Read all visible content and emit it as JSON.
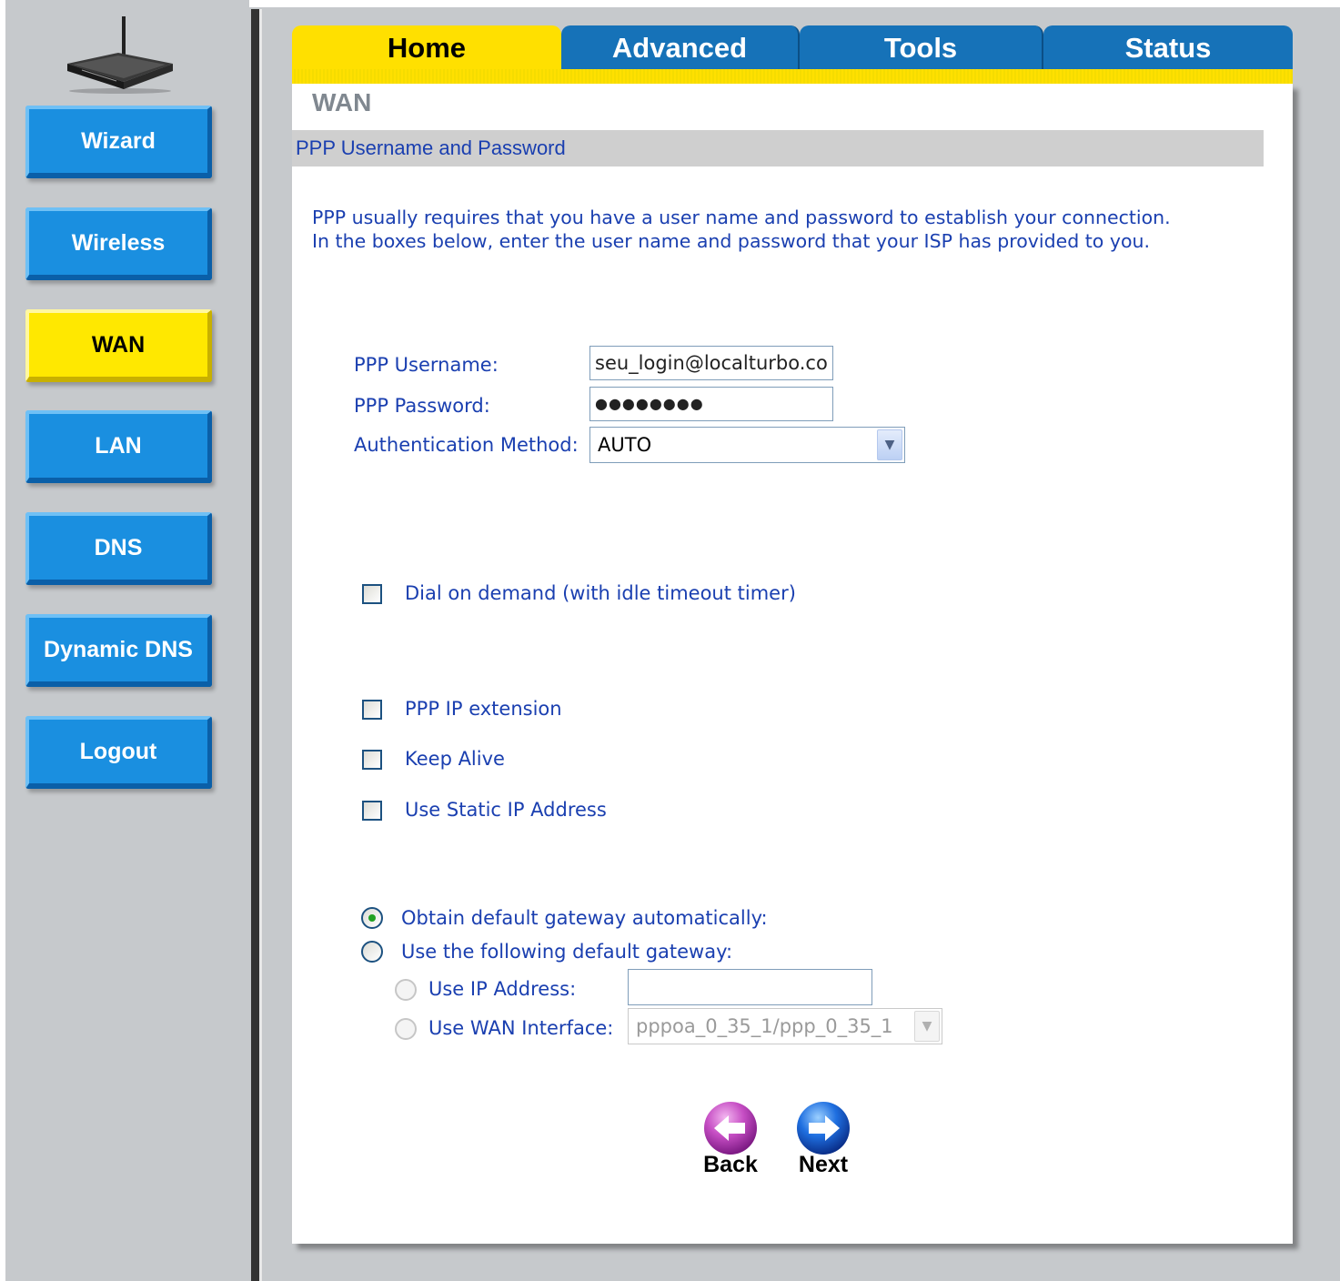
{
  "sidebar": {
    "items": [
      {
        "label": "Wizard",
        "active": false
      },
      {
        "label": "Wireless",
        "active": false
      },
      {
        "label": "WAN",
        "active": true
      },
      {
        "label": "LAN",
        "active": false
      },
      {
        "label": "DNS",
        "active": false
      },
      {
        "label": "Dynamic DNS",
        "active": false
      },
      {
        "label": "Logout",
        "active": false
      }
    ]
  },
  "tabs": [
    {
      "label": "Home",
      "active": true
    },
    {
      "label": "Advanced",
      "active": false
    },
    {
      "label": "Tools",
      "active": false
    },
    {
      "label": "Status",
      "active": false
    }
  ],
  "page": {
    "title": "WAN",
    "section_header": "PPP Username and Password",
    "intro_line1": "PPP usually requires that you have a user name and password to establish your connection.",
    "intro_line2": "In the boxes below, enter the user name and password that your ISP has provided to you."
  },
  "form": {
    "username_label": "PPP Username:",
    "username_value": "seu_login@localturbo.co",
    "password_label": "PPP Password:",
    "password_value": "●●●●●●●●",
    "auth_label": "Authentication Method:",
    "auth_value": "AUTO",
    "dial_on_demand_label": "Dial on demand (with idle timeout timer)",
    "ppp_ip_extension_label": "PPP IP extension",
    "keep_alive_label": "Keep Alive",
    "static_ip_label": "Use Static IP Address",
    "obtain_gateway_label": "Obtain default gateway automatically:",
    "use_following_gateway_label": "Use the following default gateway:",
    "use_ip_address_label": "Use IP Address:",
    "use_ip_address_value": "",
    "use_wan_interface_label": "Use WAN Interface:",
    "wan_interface_value": "pppoa_0_35_1/ppp_0_35_1"
  },
  "buttons": {
    "back_label": "Back",
    "next_label": "Next"
  },
  "colors": {
    "accent_blue": "#1a8fe0",
    "active_yellow": "#ffe800",
    "text_blue": "#1a3fb0",
    "back_purple": "#b03ab8",
    "next_blue": "#1a5fd0"
  },
  "icons": {
    "logo": "router-icon",
    "back": "arrow-left-icon",
    "next": "arrow-right-icon"
  }
}
